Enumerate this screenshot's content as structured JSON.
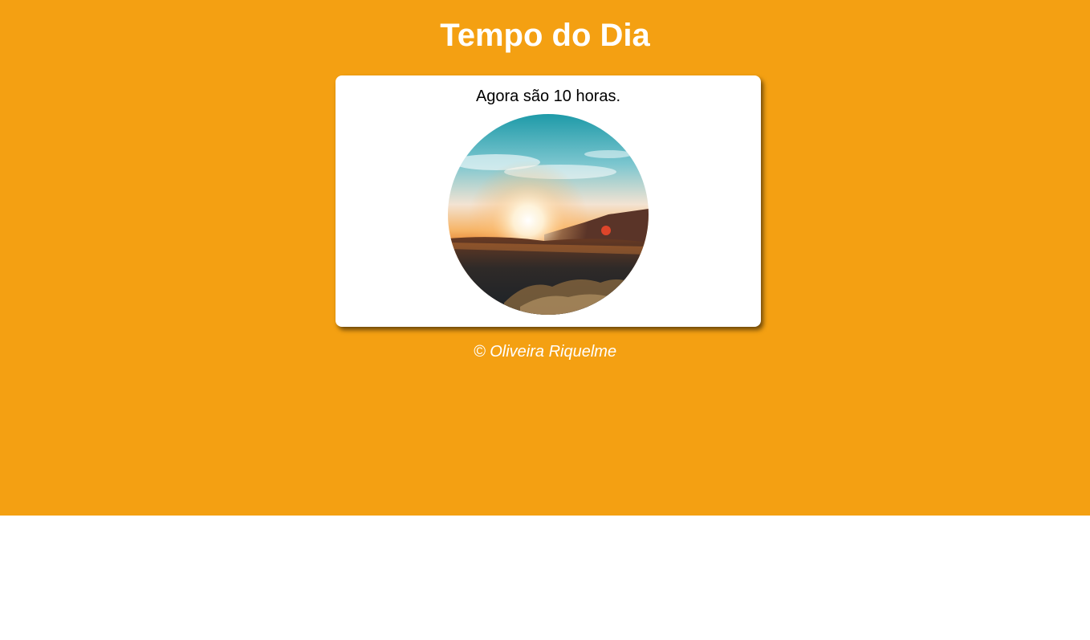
{
  "header": {
    "title": "Tempo do Dia"
  },
  "card": {
    "time_message": "Agora são 10 horas."
  },
  "footer": {
    "text": "© Oliveira Riquelme"
  },
  "colors": {
    "background": "#f4a012",
    "card": "#ffffff",
    "title_text": "#ffffff"
  }
}
